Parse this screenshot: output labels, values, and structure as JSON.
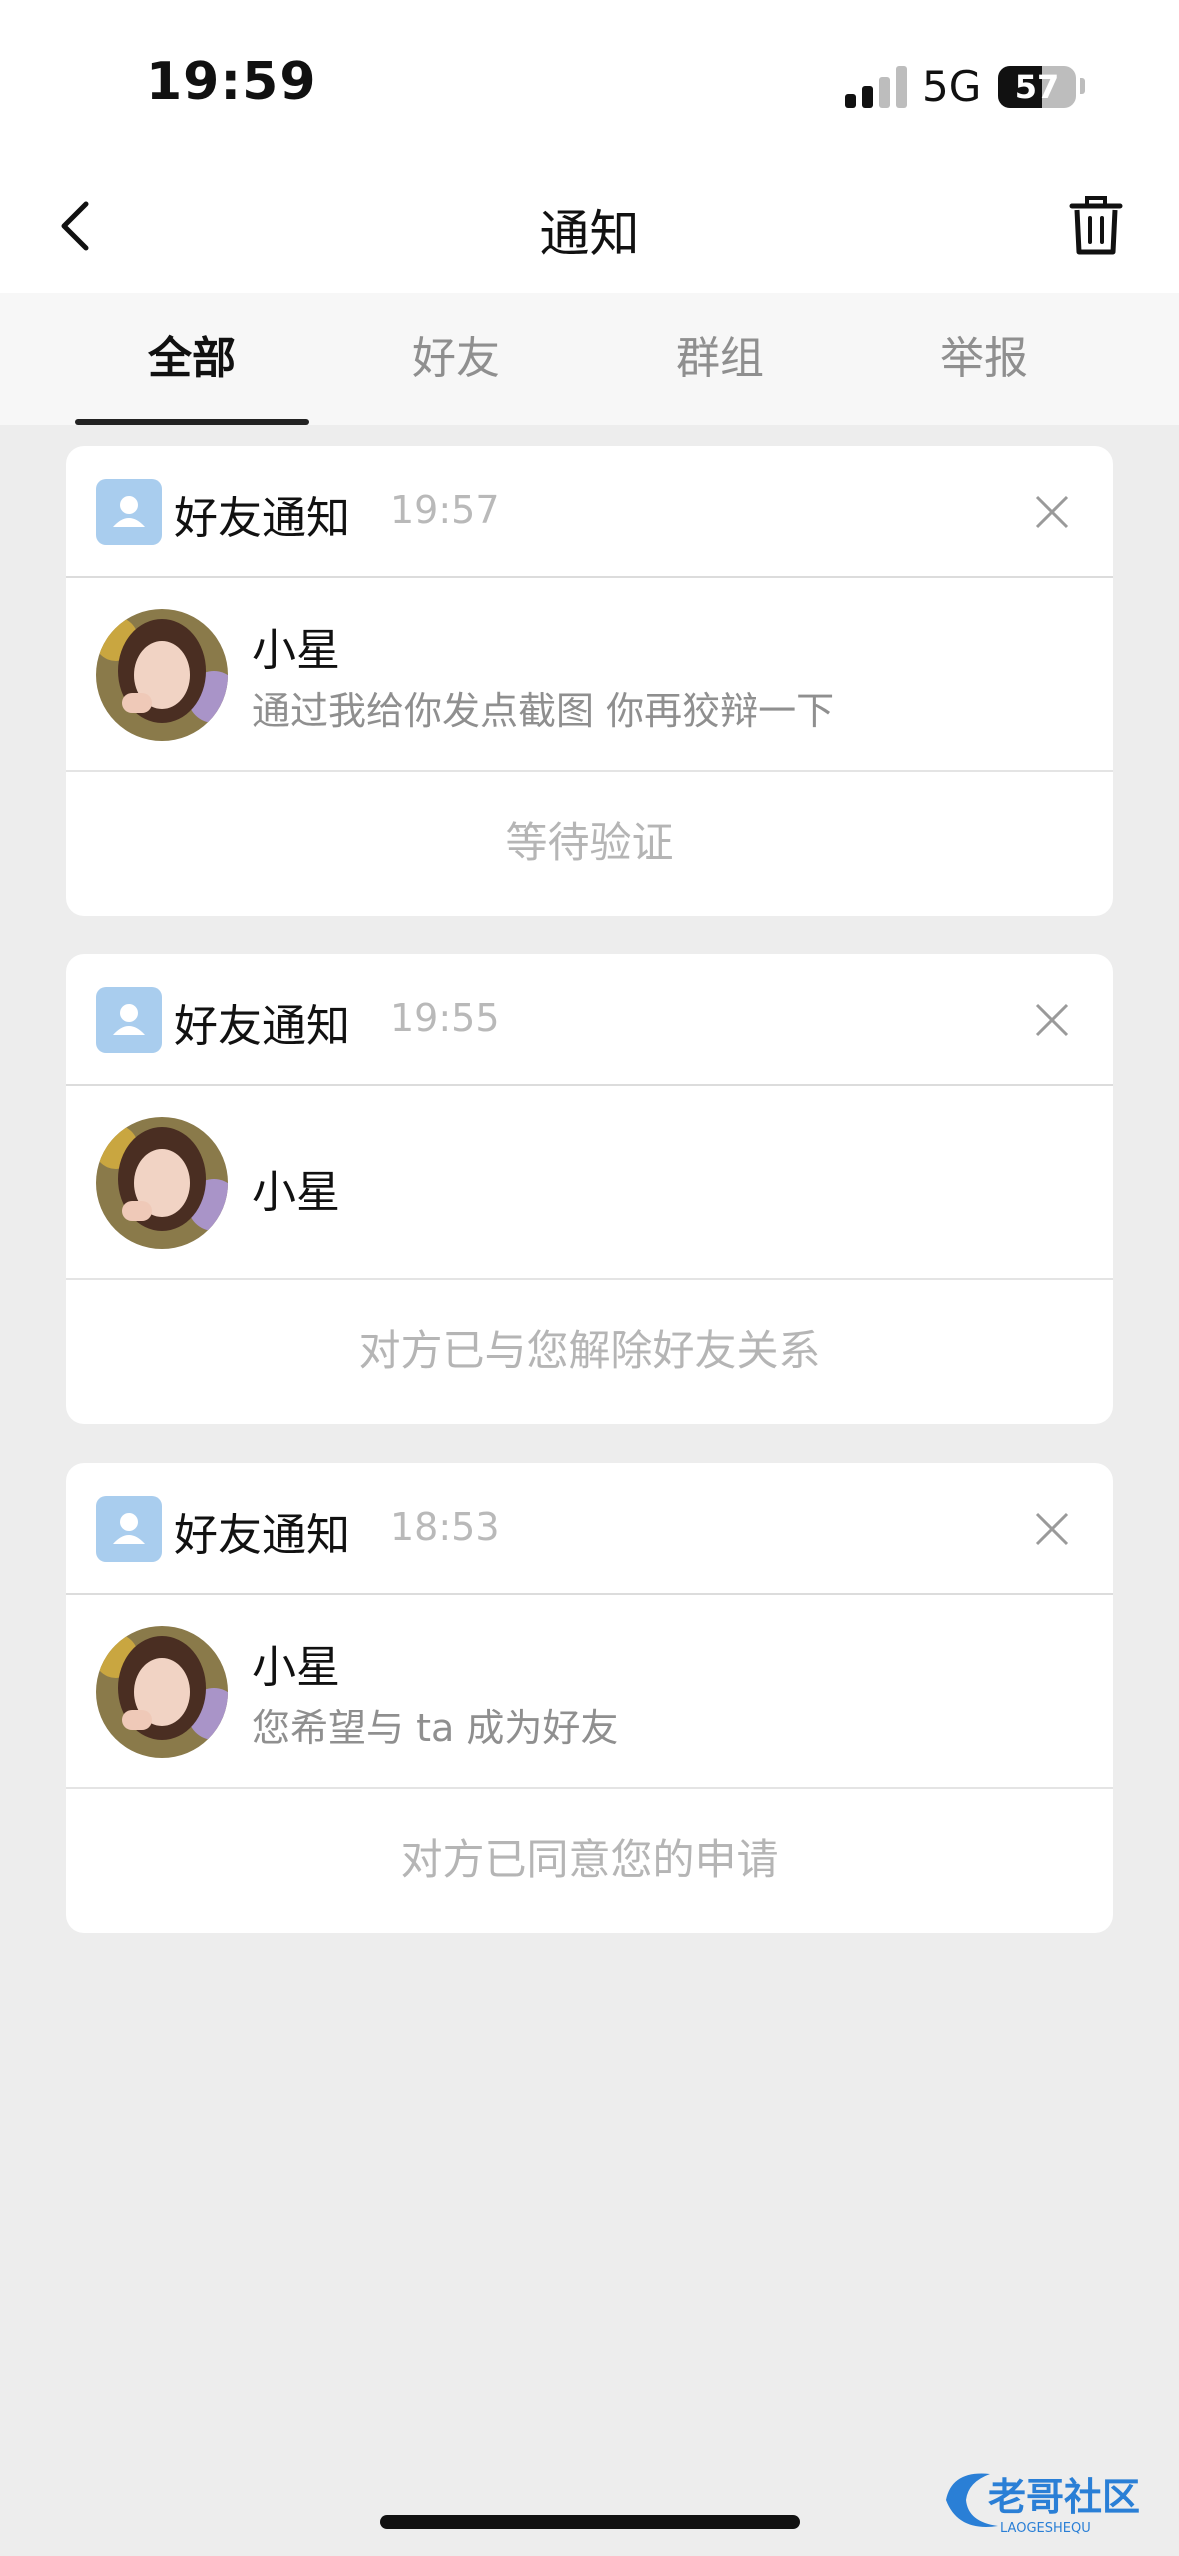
{
  "status_bar": {
    "time": "19:59",
    "network": "5G",
    "battery_level": 57,
    "battery_text": "57"
  },
  "header": {
    "title": "通知",
    "back_icon": "chevron-left-icon",
    "trash_icon": "trash-icon"
  },
  "tabs": [
    {
      "label": "全部",
      "active": true
    },
    {
      "label": "好友",
      "active": false
    },
    {
      "label": "群组",
      "active": false
    },
    {
      "label": "举报",
      "active": false
    }
  ],
  "notifications": [
    {
      "type_label": "好友通知",
      "time": "19:57",
      "name": "小星",
      "message": "通过我给你发点截图 你再狡辩一下",
      "status": "等待验证"
    },
    {
      "type_label": "好友通知",
      "time": "19:55",
      "name": "小星",
      "message": "",
      "status": "对方已与您解除好友关系"
    },
    {
      "type_label": "好友通知",
      "time": "18:53",
      "name": "小星",
      "message": "您希望与 ta 成为好友",
      "status": "对方已同意您的申请"
    }
  ],
  "watermark": {
    "title": "老哥社区",
    "subtitle": "LAOGESHEQU"
  },
  "colors": {
    "background": "#ededed",
    "card": "#ffffff",
    "icon_blue": "#a9cdee",
    "muted_text": "#b5b5b5"
  }
}
